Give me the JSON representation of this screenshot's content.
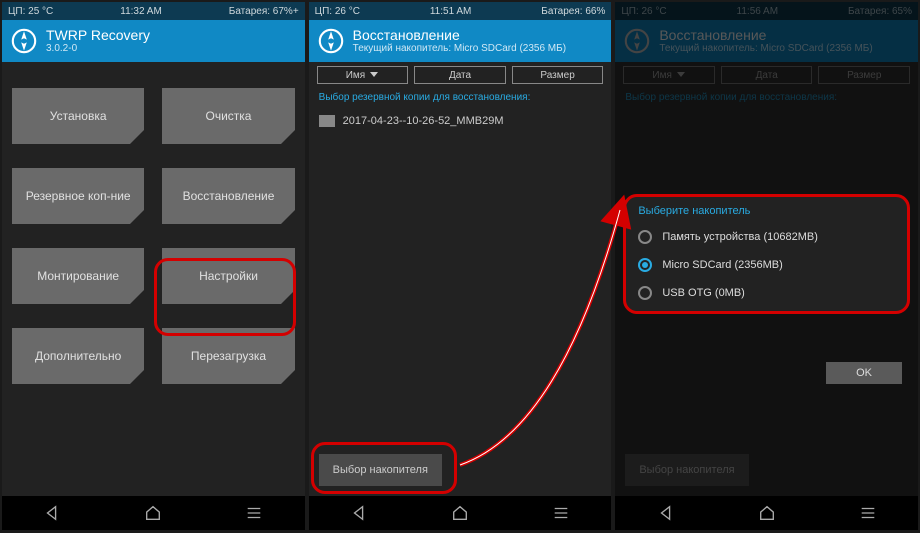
{
  "p1": {
    "status": {
      "cpu": "ЦП: 25 °C",
      "time": "11:32 AM",
      "batt": "Батарея: 67%+"
    },
    "title": "TWRP Recovery",
    "subtitle": "3.0.2-0",
    "tiles": [
      "Установка",
      "Очистка",
      "Резервное коп-ние",
      "Восстановление",
      "Монтирование",
      "Настройки",
      "Дополнительно",
      "Перезагрузка"
    ]
  },
  "p2": {
    "status": {
      "cpu": "ЦП: 26 °C",
      "time": "11:51 AM",
      "batt": "Батарея: 66%"
    },
    "title": "Восстановление",
    "subtitle": "Текущий накопитель: Micro SDCard (2356 МБ)",
    "sort": {
      "name": "Имя",
      "date": "Дата",
      "size": "Размер"
    },
    "hint": "Выбор резервной копии для восстановления:",
    "file": "2017-04-23--10-26-52_MMB29M",
    "select_btn": "Выбор накопителя"
  },
  "p3": {
    "status": {
      "cpu": "ЦП: 26 °C",
      "time": "11:56 AM",
      "batt": "Батарея: 65%"
    },
    "title": "Восстановление",
    "subtitle": "Текущий накопитель: Micro SDCard (2356 МБ)",
    "sort": {
      "name": "Имя",
      "date": "Дата",
      "size": "Размер"
    },
    "hint": "Выбор резервной копии для восстановления:",
    "dialog_title": "Выберите накопитель",
    "opts": [
      "Память устройства (10682MB)",
      "Micro SDCard (2356MB)",
      "USB OTG (0MB)"
    ],
    "ok": "OK",
    "select_btn": "Выбор накопителя"
  }
}
